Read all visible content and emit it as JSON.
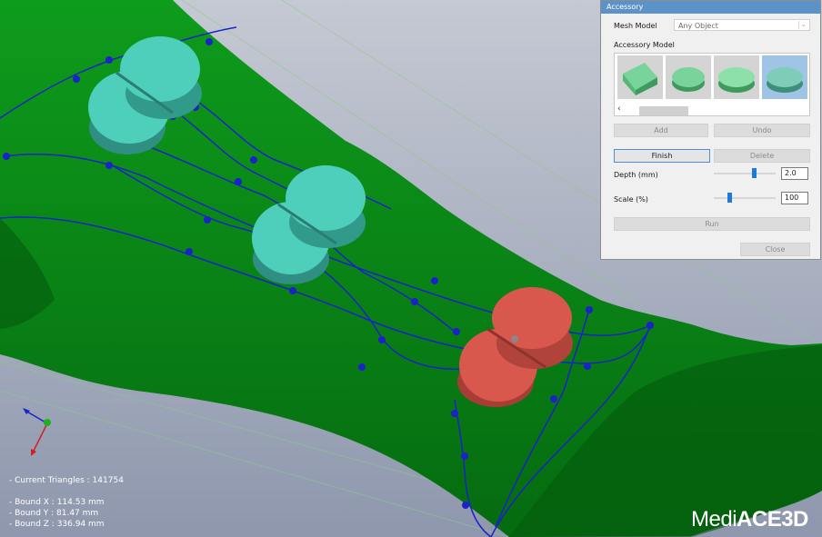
{
  "panel": {
    "title": "Accessory",
    "mesh_model_label": "Mesh Model",
    "mesh_model_value": "Any Object",
    "accessory_model_label": "Accessory Model",
    "thumbnails": [
      "bar-model",
      "round-cap-model",
      "oval-cap-model",
      "oval-cap-model-selected"
    ],
    "selected_thumbnail": 3,
    "add_label": "Add",
    "undo_label": "Undo",
    "finish_label": "Finish",
    "delete_label": "Delete",
    "depth_label": "Depth (mm)",
    "depth_value": "2.0",
    "scale_label": "Scale (%)",
    "scale_value": "100",
    "run_label": "Run",
    "close_label": "Close",
    "depth_slider_fraction": 0.65,
    "scale_slider_fraction": 0.25
  },
  "viewport": {
    "current_triangles": "- Current Triangles : 141754",
    "bound_x": "- Bound X : 114.53 mm",
    "bound_y": "- Bound Y : 81.47 mm",
    "bound_z": "- Bound Z : 336.94 mm",
    "logo_text_1": "Medi",
    "logo_text_2": "ACE3D"
  },
  "colors": {
    "background": "#9aa3b8",
    "mesh": "#0b8a17",
    "buckle": "#4ecfbb",
    "buckle_selected": "#d9584e",
    "curve": "#1a22c8",
    "accent": "#1f79d9"
  }
}
